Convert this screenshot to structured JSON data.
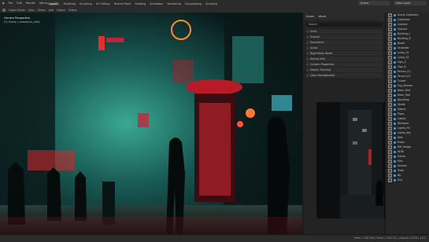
{
  "menu": [
    "File",
    "Edit",
    "Render",
    "Window",
    "Help"
  ],
  "workspace_tabs": [
    "Layout",
    "Modeling",
    "Sculpting",
    "UV Editing",
    "Texture Paint",
    "Shading",
    "Animation",
    "Rendering",
    "Compositing",
    "Scripting"
  ],
  "active_tab": "Layout",
  "scene": "Scene",
  "view_layer": "View Layer",
  "toolbar": [
    "Object Mode",
    "View",
    "Select",
    "Add",
    "Object",
    "Global"
  ],
  "viewport": {
    "label": "Camera Perspective",
    "sub": "(1) Scene | cyberpunk_alley"
  },
  "properties": {
    "tabs": [
      "Scene",
      "World"
    ],
    "search": "Search",
    "sections": [
      "Units",
      "Gravity",
      "Simulation",
      "Audio",
      "Rigid Body World",
      "Keying Sets",
      "Custom Properties",
      "Motion Tracking",
      "Color Management"
    ]
  },
  "outliner_items": [
    "Scene Collection",
    "Collection",
    "Camera",
    "Ground",
    "Building_L",
    "Building_R",
    "Booth",
    "Umbrella",
    "Lamp_01",
    "Lamp_02",
    "Sign_A",
    "Sign_B",
    "Person_01",
    "Person_02",
    "Crowd",
    "Fog_Volume",
    "Neon_Red",
    "Neon_Teal",
    "Backdrop",
    "Street",
    "Debris",
    "Pipes",
    "Cables",
    "Windows",
    "Lights_Fill",
    "Lights_Key",
    "Rain",
    "Props",
    "Ref_Image",
    "HDRI",
    "Extras",
    "Misc",
    "Volume",
    "Trash",
    "Bg",
    "End"
  ],
  "status": "Verts 1,248,306 | Faces 1,196,120 | Objects 0/128 | 3.6.0"
}
